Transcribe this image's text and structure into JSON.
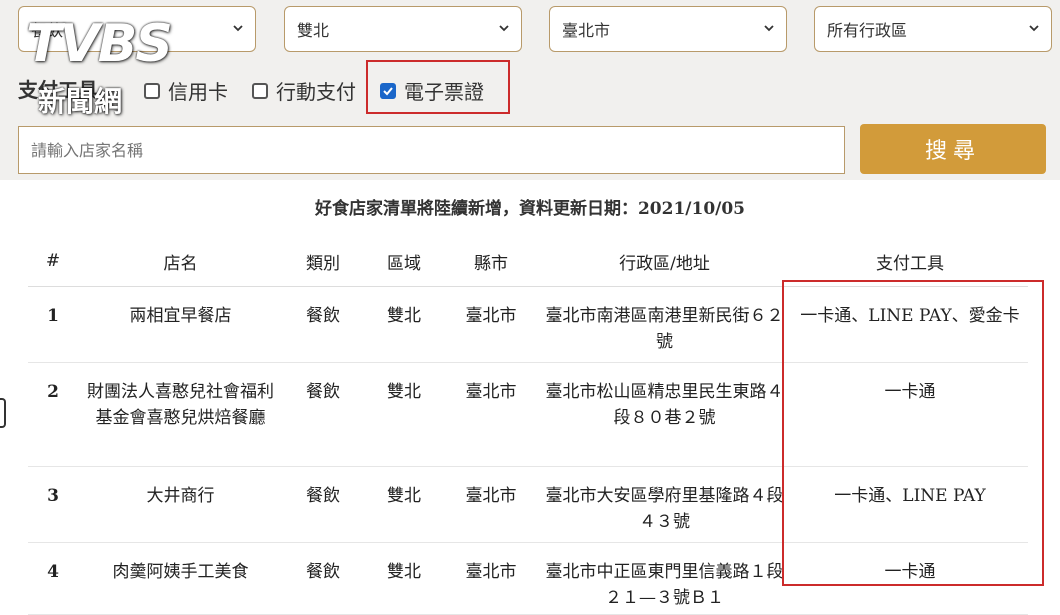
{
  "filters": {
    "category": "餐飲",
    "region": "雙北",
    "city": "臺北市",
    "district": "所有行政區"
  },
  "payment": {
    "label": "支付工具",
    "options": [
      {
        "label": "信用卡",
        "checked": false
      },
      {
        "label": "行動支付",
        "checked": false
      },
      {
        "label": "電子票證",
        "checked": true
      }
    ]
  },
  "search": {
    "placeholder": "請輸入店家名稱",
    "button_label": "搜尋"
  },
  "notice": "好食店家清單將陸續新增，資料更新日期：2021/10/05",
  "table": {
    "headers": [
      "#",
      "店名",
      "類別",
      "區域",
      "縣市",
      "行政區/地址",
      "支付工具"
    ],
    "rows": [
      {
        "no": "1",
        "name": "兩相宜早餐店",
        "type": "餐飲",
        "area": "雙北",
        "city": "臺北市",
        "address": "臺北市南港區南港里新民街６２號",
        "payment": "一卡通、LINE PAY、愛金卡"
      },
      {
        "no": "2",
        "name": "財團法人喜憨兒社會福利基金會喜憨兒烘焙餐廳",
        "type": "餐飲",
        "area": "雙北",
        "city": "臺北市",
        "address": "臺北市松山區精忠里民生東路４段８０巷２號",
        "payment": "一卡通"
      },
      {
        "no": "3",
        "name": "大井商行",
        "type": "餐飲",
        "area": "雙北",
        "city": "臺北市",
        "address": "臺北市大安區學府里基隆路４段４３號",
        "payment": "一卡通、LINE PAY"
      },
      {
        "no": "4",
        "name": "肉羹阿姨手工美食",
        "type": "餐飲",
        "area": "雙北",
        "city": "臺北市",
        "address": "臺北市中正區東門里信義路１段２１—３號Ｂ１",
        "payment": "一卡通"
      }
    ]
  },
  "watermark": {
    "brand": "TVBS",
    "sub": "新聞網"
  },
  "colors": {
    "accent": "#d29b3a",
    "highlight": "#cc2b2b",
    "checkbox": "#1a66c9",
    "border": "#b89a6a"
  }
}
